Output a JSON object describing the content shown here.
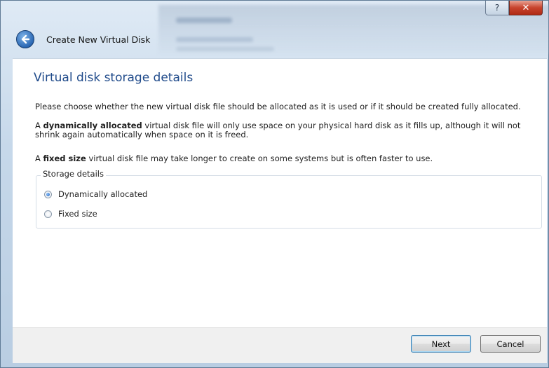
{
  "window": {
    "title": "Create New Virtual Disk",
    "help_glyph": "?",
    "close_glyph": "✕",
    "back_icon": "back-arrow-icon"
  },
  "page": {
    "heading": "Virtual disk storage details",
    "intro": "Please choose whether the new virtual disk file should be allocated as it is used or if it should be created fully allocated.",
    "dynamic_desc": {
      "prefix": "A ",
      "bold": "dynamically allocated",
      "suffix": " virtual disk file will only use space on your physical hard disk as it fills up, although it will not shrink again automatically when space on it is freed."
    },
    "fixed_desc": {
      "prefix": "A ",
      "bold": "fixed size",
      "suffix": " virtual disk file may take longer to create on some systems but is often faster to use."
    }
  },
  "storage": {
    "legend": "Storage details",
    "options": [
      {
        "label": "Dynamically allocated",
        "selected": true
      },
      {
        "label": "Fixed size",
        "selected": false
      }
    ]
  },
  "footer": {
    "next_label": "Next",
    "cancel_label": "Cancel"
  },
  "colors": {
    "heading": "#1f4a8a",
    "chrome": "#c6d8ea",
    "close": "#c7432d"
  }
}
